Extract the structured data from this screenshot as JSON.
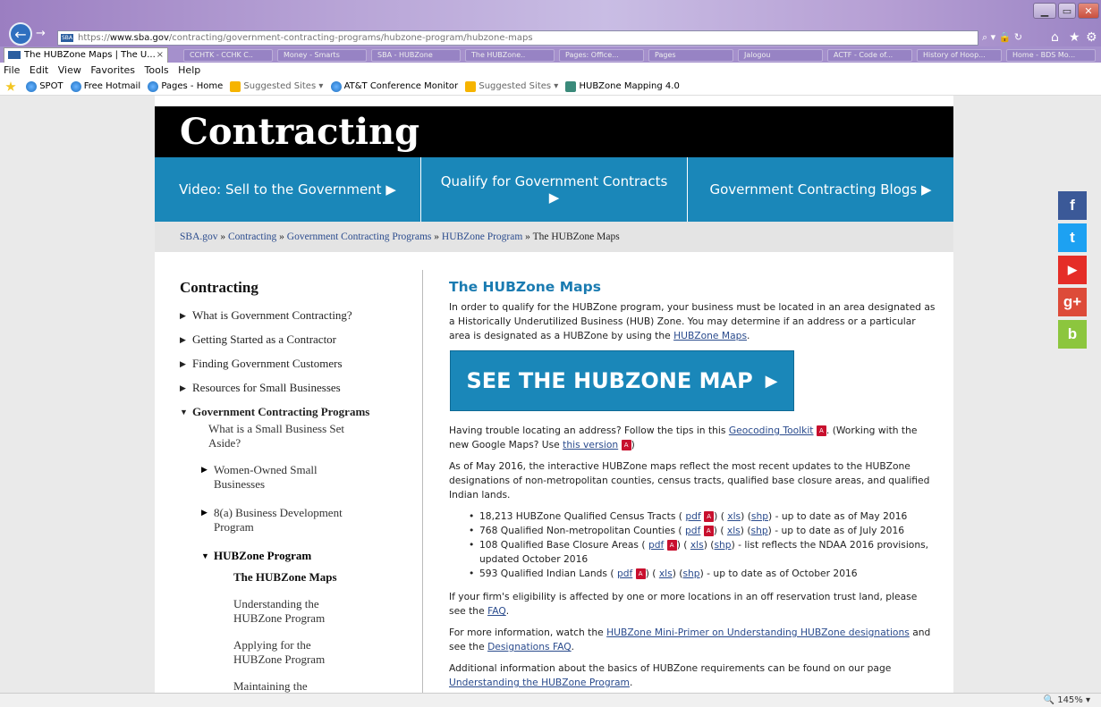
{
  "browser": {
    "address_scheme": "https://",
    "address_domain": "www.sba.gov",
    "address_path": "/contracting/government-contracting-programs/hubzone-program/hubzone-maps",
    "tab_title": "The HUBZone Maps | The U...",
    "tab_close": "×",
    "ghost_tabs": [
      "CCHTK - CCHK C..",
      "Money - Smarts",
      "SBA - HUBZone",
      "The HUBZone..",
      "Pages: Office...",
      "Pages",
      "Jalogou",
      "ACTF - Code of...",
      "History of Hoop...",
      "Home - BDS Mo..."
    ],
    "menu": [
      "File",
      "Edit",
      "View",
      "Favorites",
      "Tools",
      "Help"
    ],
    "favorites": [
      {
        "label": "SPOT",
        "icon": "ie"
      },
      {
        "label": "Free Hotmail",
        "icon": "ie"
      },
      {
        "label": "Pages - Home",
        "icon": "ie"
      },
      {
        "label": "Suggested Sites ▾",
        "icon": "bing"
      },
      {
        "label": "AT&T Conference Monitor",
        "icon": "ie"
      },
      {
        "label": "Suggested Sites ▾",
        "icon": "bing"
      },
      {
        "label": "HUBZone Mapping 4.0",
        "icon": "map"
      }
    ],
    "zoom": "145%"
  },
  "hero": {
    "title": "Contracting"
  },
  "nav": [
    {
      "label": "Video: Sell to the Government ▶"
    },
    {
      "label": "Qualify for Government Contracts ▶"
    },
    {
      "label": "Government Contracting Blogs ▶"
    }
  ],
  "breadcrumb": {
    "items": [
      "SBA.gov",
      "Contracting",
      "Government Contracting Programs",
      "HUBZone Program"
    ],
    "sep": " » ",
    "current": "The HUBZone Maps"
  },
  "sidebar": {
    "title": "Contracting",
    "items": [
      "What is Government Contracting?",
      "Getting Started as a Contractor",
      "Finding Government Customers",
      "Resources for Small Businesses"
    ],
    "open_item": "Government Contracting Programs",
    "sub_items": [
      {
        "label": "What is a Small Business Set Aside?"
      },
      {
        "label": "Women-Owned Small Businesses"
      },
      {
        "label": "8(a) Business Development Program"
      }
    ],
    "hubzone_label": "HUBZone Program",
    "hubzone_children": [
      "The HUBZone Maps",
      "Understanding the HUBZone Program",
      "Applying for the HUBZone Program",
      "Maintaining the HUBZone Certification"
    ]
  },
  "main": {
    "title": "The HUBZone Maps",
    "intro_1": "In order to qualify for the HUBZone program, your business must be located in an area designated as a Historically Underutilized Business (HUB) Zone. You may determine if an address or a particular area is designated as a HUBZone by using the ",
    "intro_link": "HUBZone Maps",
    "intro_end": ".",
    "cta": "SEE THE HUBZONE MAP",
    "trouble_1": "Having trouble locating an address? Follow the tips in this ",
    "trouble_link": "Geocoding Toolkit",
    "trouble_2": ". (Working with the new Google Maps? Use ",
    "trouble_link2": "this version",
    "trouble_3": ")",
    "update_para": "As of May 2016, the interactive HUBZone maps reflect the most recent updates to the HUBZone designations of non-metropolitan counties, census tracts, qualified base closure areas, and qualified Indian lands.",
    "bullets": [
      {
        "lead": "18,213 HUBZone Qualified Census Tracts ( ",
        "tail": " - up to date as of May 2016"
      },
      {
        "lead": "768 Qualified Non-metropolitan Counties  ( ",
        "tail": " - up to date as of July 2016"
      },
      {
        "lead": "108 Qualified Base Closure Areas  ( ",
        "tail": " - list reflects the NDAA 2016 provisions, updated October 2016"
      },
      {
        "lead": "593 Qualified Indian Lands ( ",
        "tail": " - up to date as of October 2016"
      }
    ],
    "link_pdf": "pdf",
    "link_xls": "xls",
    "link_shp": "shp",
    "faq_1": "If your firm's eligibility is affected by one or more locations in an off reservation trust land, please see the ",
    "faq_link": "FAQ",
    "faq_end": ".",
    "primer_1": "For more information, watch the ",
    "primer_link": "HUBZone Mini-Primer on Understanding HUBZone designations",
    "primer_2": " and see the ",
    "primer_link2": "Designations FAQ",
    "primer_end": ".",
    "basics_1": "Additional information about the basics of HUBZone requirements can be found on our page ",
    "basics_link": "Understanding the HUBZone Program",
    "basics_end": "."
  },
  "social": [
    {
      "icon": "facebook-icon",
      "glyph": "f",
      "color": "#3b5998"
    },
    {
      "icon": "twitter-icon",
      "glyph": "t",
      "color": "#1da1f2"
    },
    {
      "icon": "youtube-icon",
      "glyph": "▶",
      "color": "#e52d27"
    },
    {
      "icon": "googleplus-icon",
      "glyph": "g+",
      "color": "#dd4b39"
    },
    {
      "icon": "blogger-icon",
      "glyph": "b",
      "color": "#8cc63e"
    }
  ]
}
